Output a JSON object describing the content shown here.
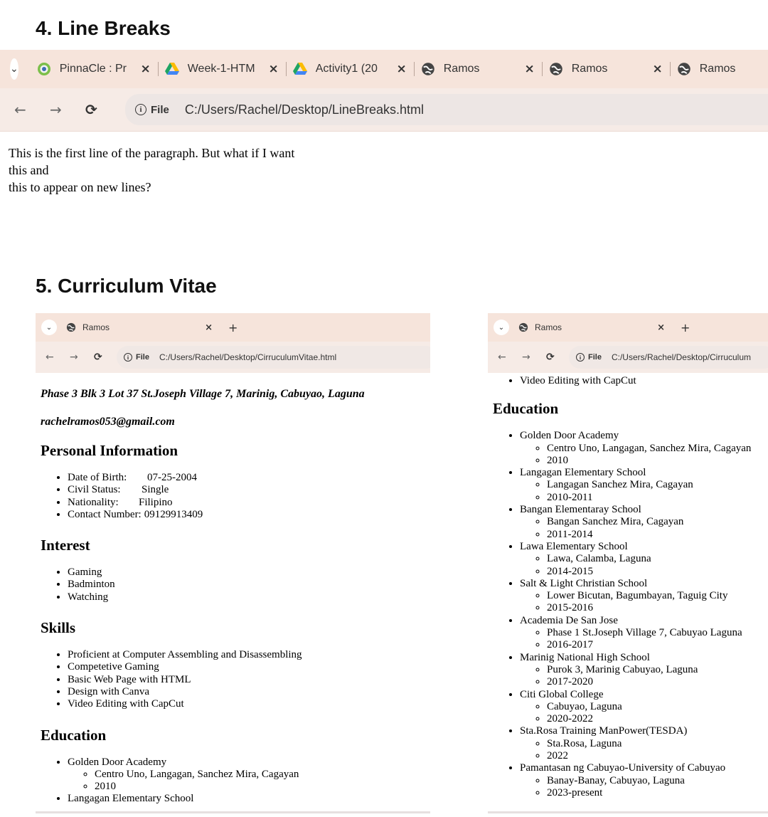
{
  "headings": {
    "line_breaks": "4.  Line Breaks",
    "cv": "5.  Curriculum Vitae"
  },
  "line_breaks_browser": {
    "tabs": [
      {
        "label": "PinnaCle : Pr",
        "icon": "pinnacle-icon"
      },
      {
        "label": "Week-1-HTM",
        "icon": "google-drive-icon"
      },
      {
        "label": "Activity1 (20",
        "icon": "google-drive-icon"
      },
      {
        "label": "Ramos",
        "icon": "globe-icon"
      },
      {
        "label": "Ramos",
        "icon": "globe-icon"
      },
      {
        "label": "Ramos",
        "icon": "globe-icon"
      }
    ],
    "file_chip": "File",
    "url": "C:/Users/Rachel/Desktop/LineBreaks.html",
    "paragraph_lines": [
      "This is the first line of the paragraph. But what if I want",
      "this and",
      "this to appear on new lines?"
    ]
  },
  "cv_browser_left": {
    "tab_label": "Ramos",
    "file_chip": "File",
    "url": "C:/Users/Rachel/Desktop/CirruculumVitae.html",
    "address": "Phase 3 Blk 3 Lot 37 St.Joseph Village 7, Marinig, Cabuyao, Laguna",
    "email": "rachelramos053@gmail.com",
    "personal_heading": "Personal Information",
    "personal": [
      {
        "label": "Date of Birth:",
        "value": "07-25-2004"
      },
      {
        "label": "Civil Status:",
        "value": "Single"
      },
      {
        "label": "Nationality:",
        "value": "Filipino"
      },
      {
        "label": "Contact Number:",
        "value": "09129913409"
      }
    ],
    "interest_heading": "Interest",
    "interests": [
      "Gaming",
      "Badminton",
      "Watching"
    ],
    "skills_heading": "Skills",
    "skills": [
      "Proficient at Computer Assembling and Disassembling",
      "Competetive Gaming",
      "Basic Web Page with HTML",
      "Design with Canva",
      "Video Editing with CapCut"
    ],
    "education_heading": "Education",
    "education_preview": [
      {
        "school": "Golden Door Academy",
        "details": [
          "Centro Uno, Langagan, Sanchez Mira, Cagayan",
          "2010"
        ]
      },
      {
        "school": "Langagan Elementary School",
        "details": []
      }
    ]
  },
  "cv_browser_right": {
    "tab_label": "Ramos",
    "file_chip": "File",
    "url": "C:/Users/Rachel/Desktop/Cirruculum",
    "top_item": "Video Editing with CapCut",
    "education_heading": "Education",
    "education": [
      {
        "school": "Golden Door Academy",
        "details": [
          "Centro Uno, Langagan, Sanchez Mira, Cagayan",
          "2010"
        ]
      },
      {
        "school": "Langagan Elementary School",
        "details": [
          "Langagan Sanchez Mira, Cagayan",
          "2010-2011"
        ]
      },
      {
        "school": "Bangan Elementaray School",
        "details": [
          "Bangan Sanchez Mira, Cagayan",
          "2011-2014"
        ]
      },
      {
        "school": "Lawa Elementary School",
        "details": [
          "Lawa, Calamba, Laguna",
          "2014-2015"
        ]
      },
      {
        "school": "Salt & Light Christian School",
        "details": [
          "Lower Bicutan, Bagumbayan, Taguig City",
          "2015-2016"
        ]
      },
      {
        "school": "Academia De San Jose",
        "details": [
          "Phase 1 St.Joseph Village 7, Cabuyao Laguna",
          "2016-2017"
        ]
      },
      {
        "school": "Marinig National High School",
        "details": [
          "Purok 3, Marinig Cabuyao, Laguna",
          "2017-2020"
        ]
      },
      {
        "school": "Citi Global College",
        "details": [
          "Cabuyao, Laguna",
          "2020-2022"
        ]
      },
      {
        "school": "Sta.Rosa Training ManPower(TESDA)",
        "details": [
          "Sta.Rosa, Laguna",
          "2022"
        ]
      },
      {
        "school": "Pamantasan ng Cabuyao-University of Cabuyao",
        "details": [
          "Banay-Banay, Cabuyao, Laguna",
          "2023-present"
        ]
      }
    ]
  }
}
